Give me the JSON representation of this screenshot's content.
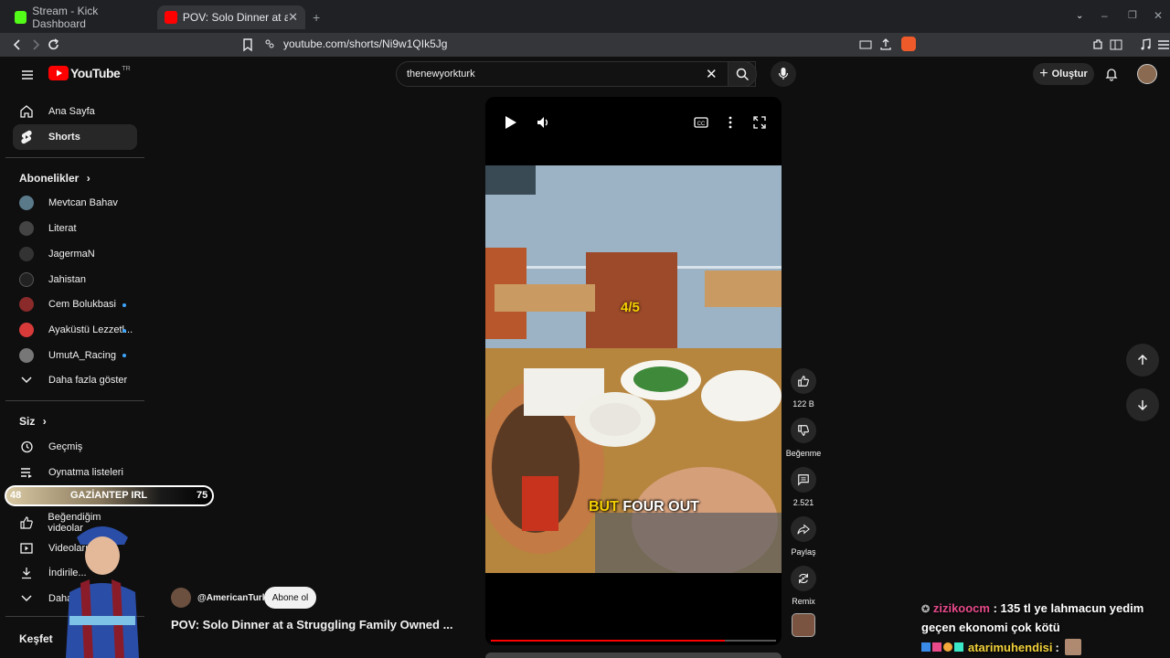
{
  "browser": {
    "tabs": [
      {
        "title": "Stream - Kick Dashboard",
        "active": false
      },
      {
        "title": "POV: Solo Dinner at a Struggling",
        "active": true
      }
    ],
    "url": "youtube.com/shorts/Ni9w1QIk5Jg"
  },
  "youtube": {
    "logo_text": "YouTube",
    "logo_region": "TR",
    "search_value": "thenewyorkturk",
    "create_label": "Oluştur"
  },
  "sidebar": {
    "main_items": [
      {
        "label": "Ana Sayfa",
        "icon": "home-icon"
      },
      {
        "label": "Shorts",
        "icon": "shorts-icon",
        "active": true
      }
    ],
    "subscriptions_title": "Abonelikler",
    "subscriptions": [
      {
        "label": "Mevtcan Bahav",
        "live": false,
        "color": "#5a7a8a"
      },
      {
        "label": "Literat",
        "live": false,
        "color": "#444444"
      },
      {
        "label": "JagermaN",
        "live": false,
        "color": "#333333"
      },
      {
        "label": "Jahistan",
        "live": false,
        "color": "#222222"
      },
      {
        "label": "Cem Bolukbasi",
        "live": true,
        "color": "#8a2a2a"
      },
      {
        "label": "Ayaküstü Lezzetl...",
        "live": true,
        "color": "#d83a3a"
      },
      {
        "label": "UmutA_Racing",
        "live": true,
        "color": "#777777"
      }
    ],
    "show_more": "Daha fazla göster",
    "you_title": "Siz",
    "you_items": [
      {
        "label": "Geçmiş",
        "icon": "history-icon"
      },
      {
        "label": "Oynatma listeleri",
        "icon": "playlists-icon"
      },
      {
        "label": "Beğendiğim videolar",
        "icon": "like-icon"
      },
      {
        "label": "Videoları...",
        "icon": "your-videos-icon"
      },
      {
        "label": "İndirile...",
        "icon": "download-icon"
      },
      {
        "label": "Daha...",
        "icon": "chevron-down-icon"
      }
    ],
    "explore_title": "Keşfet"
  },
  "overlay": {
    "location_bar": {
      "left": "48",
      "label": "GAZİANTEP IRL",
      "right": "75"
    },
    "chat": [
      {
        "user": "zizikoocm",
        "message": "135 tl ye lahmacun yedim geçen ekonomi çok kötü",
        "user_color": "#e64a8a"
      },
      {
        "user": "atarimuhendisi",
        "message": "",
        "user_color": "#f2d13a"
      }
    ]
  },
  "short": {
    "overlay_counter": "4/5",
    "caption_word1": "BUT",
    "caption_rest": "FOUR OUT",
    "channel": "@AmericanTurk",
    "subscribe_label": "Abone ol",
    "title": "POV: Solo Dinner at a Struggling Family Owned ...",
    "progress": 0.82,
    "actions": [
      {
        "label": "122 B",
        "icon": "like-icon"
      },
      {
        "label": "Beğenme",
        "icon": "dislike-icon"
      },
      {
        "label": "2.521",
        "icon": "comment-icon"
      },
      {
        "label": "Paylaş",
        "icon": "share-icon"
      },
      {
        "label": "Remix",
        "icon": "remix-icon"
      }
    ]
  },
  "colors": {
    "accent_red": "#ff0000",
    "bg": "#0f0f0f",
    "chip": "#272727",
    "caption_yellow": "#f5d000"
  }
}
